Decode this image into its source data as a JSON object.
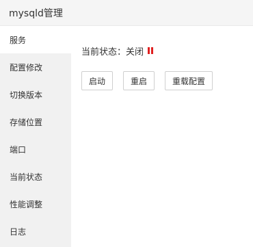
{
  "app": {
    "title": "mysqld管理"
  },
  "sidebar": {
    "items": [
      {
        "label": "服务",
        "active": true
      },
      {
        "label": "配置修改"
      },
      {
        "label": "切换版本"
      },
      {
        "label": "存储位置"
      },
      {
        "label": "端口"
      },
      {
        "label": "当前状态"
      },
      {
        "label": "性能调整"
      },
      {
        "label": "日志"
      }
    ]
  },
  "service": {
    "status_label": "当前状态：关闭",
    "status_color": "#e02020",
    "buttons": {
      "start": "启动",
      "restart": "重启",
      "reload": "重载配置"
    }
  }
}
